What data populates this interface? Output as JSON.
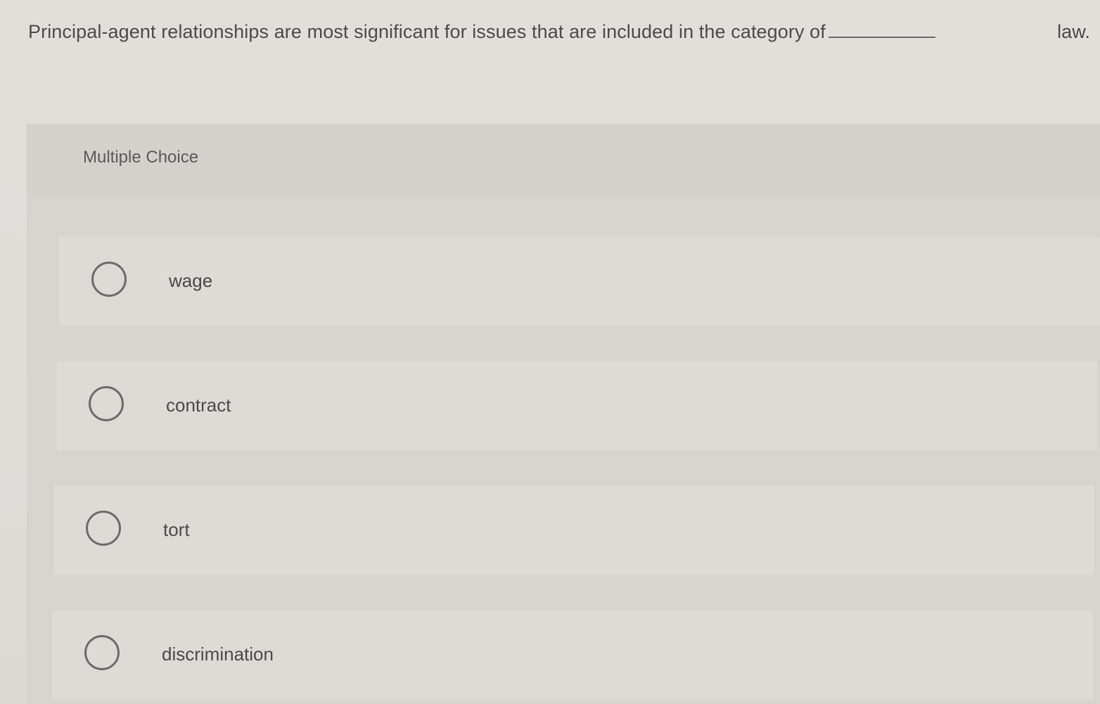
{
  "question": {
    "text_before": "Principal-agent relationships are most significant for issues that are included in the category of",
    "text_after": "law."
  },
  "multiple_choice": {
    "label": "Multiple Choice",
    "options": [
      {
        "label": "wage"
      },
      {
        "label": "contract"
      },
      {
        "label": "tort"
      },
      {
        "label": "discrimination"
      }
    ]
  }
}
